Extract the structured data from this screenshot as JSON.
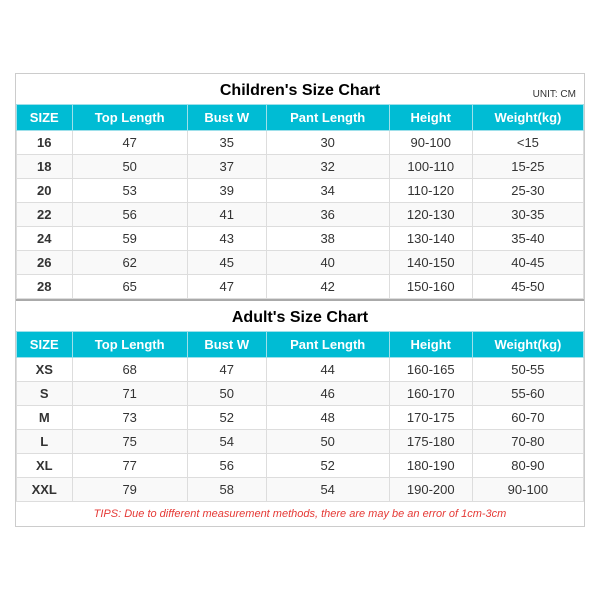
{
  "children_section": {
    "title": "Children's Size Chart",
    "unit": "UNIT: CM",
    "headers": [
      "SIZE",
      "Top Length",
      "Bust W",
      "Pant Length",
      "Height",
      "Weight(kg)"
    ],
    "rows": [
      [
        "16",
        "47",
        "35",
        "30",
        "90-100",
        "<15"
      ],
      [
        "18",
        "50",
        "37",
        "32",
        "100-110",
        "15-25"
      ],
      [
        "20",
        "53",
        "39",
        "34",
        "110-120",
        "25-30"
      ],
      [
        "22",
        "56",
        "41",
        "36",
        "120-130",
        "30-35"
      ],
      [
        "24",
        "59",
        "43",
        "38",
        "130-140",
        "35-40"
      ],
      [
        "26",
        "62",
        "45",
        "40",
        "140-150",
        "40-45"
      ],
      [
        "28",
        "65",
        "47",
        "42",
        "150-160",
        "45-50"
      ]
    ]
  },
  "adult_section": {
    "title": "Adult's Size Chart",
    "headers": [
      "SIZE",
      "Top Length",
      "Bust W",
      "Pant Length",
      "Height",
      "Weight(kg)"
    ],
    "rows": [
      [
        "XS",
        "68",
        "47",
        "44",
        "160-165",
        "50-55"
      ],
      [
        "S",
        "71",
        "50",
        "46",
        "160-170",
        "55-60"
      ],
      [
        "M",
        "73",
        "52",
        "48",
        "170-175",
        "60-70"
      ],
      [
        "L",
        "75",
        "54",
        "50",
        "175-180",
        "70-80"
      ],
      [
        "XL",
        "77",
        "56",
        "52",
        "180-190",
        "80-90"
      ],
      [
        "XXL",
        "79",
        "58",
        "54",
        "190-200",
        "90-100"
      ]
    ]
  },
  "tips": "TIPS: Due to different measurement methods, there are may be an error of 1cm-3cm"
}
